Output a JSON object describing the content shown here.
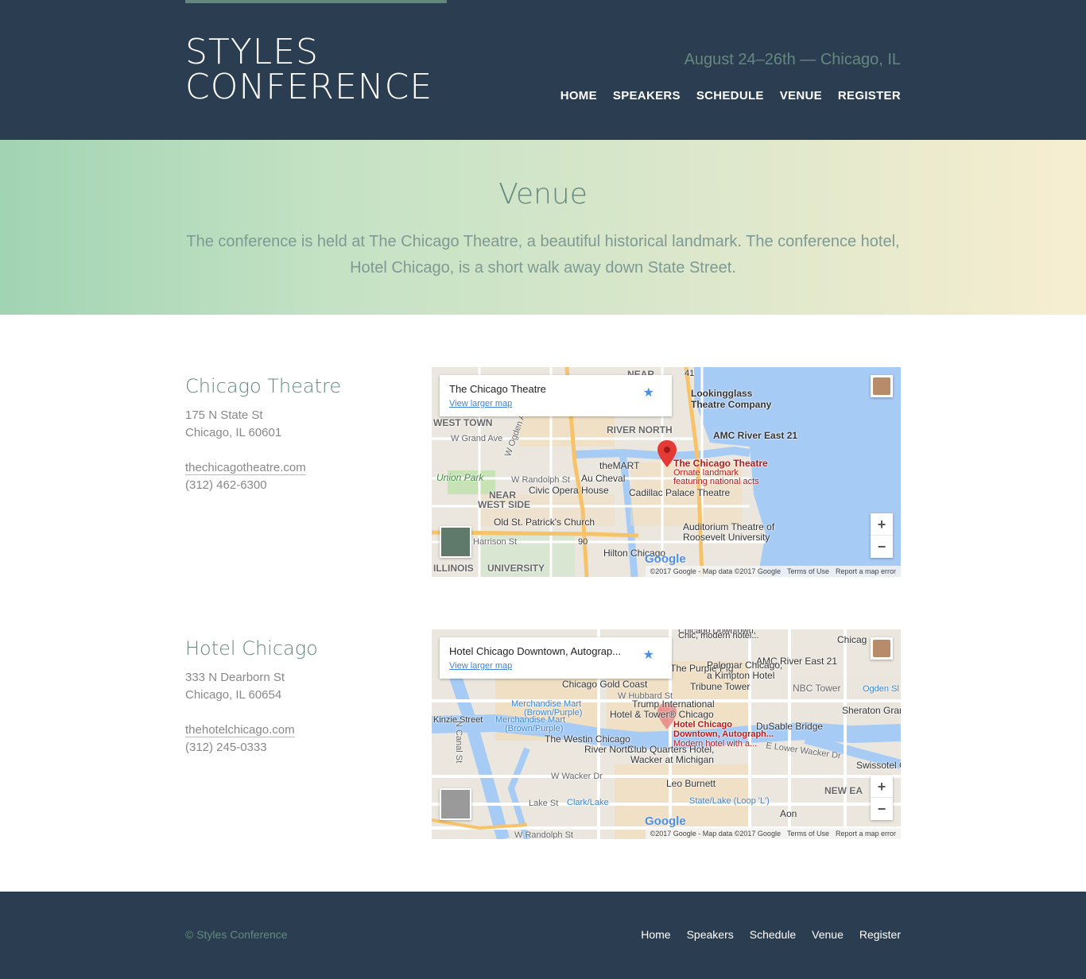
{
  "header": {
    "logo_line1": "STYLES",
    "logo_line2": "CONFERENCE",
    "tagline": "August 24–26th — Chicago, IL",
    "nav": [
      "HOME",
      "SPEAKERS",
      "SCHEDULE",
      "VENUE",
      "REGISTER"
    ]
  },
  "hero": {
    "title": "Venue",
    "text": "The conference is held at The Chicago Theatre, a beautiful historical landmark. The conference hotel, Hotel Chicago, is a short walk away down State Street."
  },
  "venues": [
    {
      "name": "Chicago Theatre",
      "address1": "175 N State St",
      "address2": "Chicago, IL 60601",
      "website": "thechicagotheatre.com",
      "phone": "(312) 462-6300",
      "map": {
        "card_title": "The Chicago Theatre",
        "card_link": "View larger map",
        "labels": {
          "l1": "Lookingglass",
          "l2": "Theatre Company",
          "l3": "AMC River East 21",
          "l4": "RIVER NORTH",
          "l5": "WEST TOWN",
          "l6": "W Grand Ave",
          "l7": "theMART",
          "l8": "The Chicago Theatre",
          "l9": "Ornate landmark",
          "l10": "featuring national acts",
          "l11": "Union Park",
          "l12": "W Randolph St",
          "l13": "Au Cheval",
          "l14": "Civic Opera House",
          "l15": "Cadillac Palace Theatre",
          "l16": "NEAR",
          "l17": "WEST SIDE",
          "l18": "Old St. Patrick's Church",
          "l19": "Auditorium Theatre of",
          "l20": "Roosevelt University",
          "l21": "Hilton Chicago",
          "l22": "ILLINOIS",
          "l23": "UNIVERSITY",
          "l24": "W Ogden Ave",
          "l25": "NEAR",
          "l26": "Harrison St",
          "l27": "90",
          "l28": "41"
        }
      }
    },
    {
      "name": "Hotel Chicago",
      "address1": "333 N Dearborn St",
      "address2": "Chicago, IL 60654",
      "website": "thehotelchicago.com",
      "phone": "(312) 245-0333",
      "map": {
        "card_title": "Hotel Chicago Downtown, Autograp...",
        "card_link": "View larger map",
        "labels": {
          "l1": "Chicago Downtown,",
          "l2": "Chic, modern hotel...",
          "l3": "AMC River East 21",
          "l4": "The Purple Pig",
          "l5": "Palomar Chicago,",
          "l6": "a Kimpton Hotel",
          "l7": "Tribune Tower",
          "l8": "NBC Tower",
          "l9": "Chicago Gold Coast",
          "l10": "W Hubbard St",
          "l11": "Trump International",
          "l12": "Hotel & Tower® Chicago",
          "l13": "Merchandise Mart",
          "l14": "(Brown/Purple)",
          "l15": "Hotel Chicago",
          "l16": "Downtown, Autograph...",
          "l17": "Modern hotel with a...",
          "l18": "DuSable Bridge",
          "l19": "Sheraton Grand",
          "l20": "Kinzie Street",
          "l21": "The Westin Chicago",
          "l22": "River North",
          "l23": "Club Quarters Hotel,",
          "l24": "Wacker at Michigan",
          "l25": "E Lower Wacker Dr",
          "l26": "Swissotel C",
          "l27": "N Canal St",
          "l28": "W Wacker Dr",
          "l29": "Leo Burnett",
          "l30": "State/Lake (Loop 'L')",
          "l31": "NEW EA",
          "l32": "Lake St",
          "l33": "Clark/Lake",
          "l34": "Aon",
          "l35": "W Randolph St",
          "l36": "Chicag",
          "l37": "Ogden Sl",
          "l38": "Merchandise Mart",
          "l39": "(Brown/Purple)"
        }
      }
    }
  ],
  "map_common": {
    "attrib": "©2017 Google - Map data ©2017 Google",
    "terms": "Terms of Use",
    "report": "Report a map error",
    "google": "Google",
    "zoom_in": "+",
    "zoom_out": "−",
    "star": "★"
  },
  "footer": {
    "copyright": "© Styles Conference",
    "nav": [
      "Home",
      "Speakers",
      "Schedule",
      "Venue",
      "Register"
    ]
  },
  "colors": {
    "header_bg": "#2b3e51",
    "accent": "#648880",
    "hero_gradient_start": "#a1d4b3",
    "hero_gradient_end": "#f7eed0",
    "water": "#a6cbf5",
    "map_pin": "#e53935"
  }
}
